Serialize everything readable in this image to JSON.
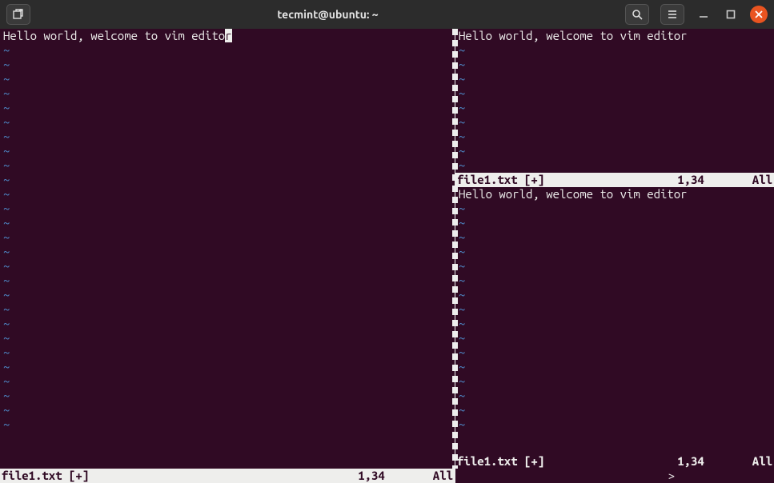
{
  "titlebar": {
    "title": "tecmint@ubuntu: ~"
  },
  "panes": {
    "left": {
      "content": "Hello world, welcome to vim edito",
      "cursor_char": "r",
      "status": {
        "filename": "file1.txt [+]",
        "position": "1,34",
        "percent": "All"
      }
    },
    "right_top": {
      "content": "Hello world, welcome to vim editor",
      "status": {
        "filename": "file1.txt [+]",
        "position": "1,34",
        "percent": "All"
      }
    },
    "right_bottom": {
      "content": "Hello world, welcome to vim editor",
      "status": {
        "filename": "file1.txt [+]",
        "position": "1,34",
        "percent": "All"
      }
    }
  },
  "cmdline": {
    "prompt": ">"
  },
  "tilde": "~"
}
